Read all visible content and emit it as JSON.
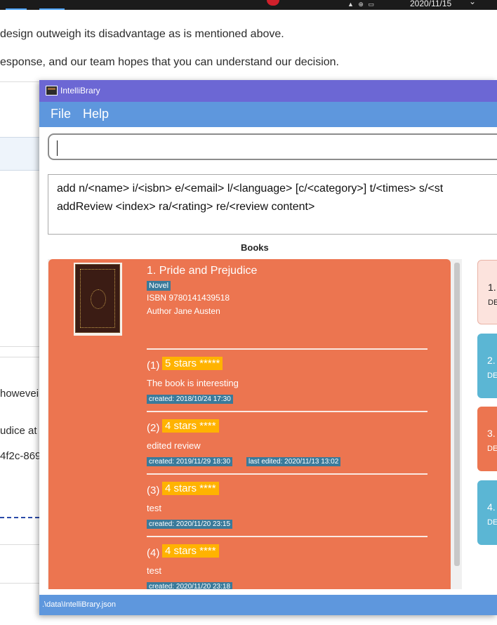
{
  "taskbar": {
    "date": "2020/11/15",
    "chevron": "⌄",
    "tray": "▲  ⊕  ▭"
  },
  "background": {
    "line1": "design outweigh its disadvantage as is mentioned above.",
    "line2": "esponse, and our team hopes that you can understand our decision.",
    "frag_however": "howevei",
    "frag_udice": "udice at",
    "frag_hash": "4f2c-869"
  },
  "window": {
    "title": "IntelliBrary",
    "menu": {
      "file": "File",
      "help": "Help"
    },
    "command": {
      "value": "",
      "placeholder": ""
    },
    "result": {
      "line1": "add n/<name> i/<isbn> e/<email> l/<language> [c/<category>] t/<times> s/<st",
      "line2": "addReview <index> ra/<rating> re/<review content>"
    },
    "books_title": "Books",
    "book": {
      "title": "1.  Pride and Prejudice",
      "tag": "Novel",
      "isbn": "ISBN 9780141439518",
      "author": "Author Jane Austen"
    },
    "reviews": [
      {
        "index": "(1)",
        "stars": "5 stars *****",
        "rating": 5,
        "text": "The book is interesting",
        "created": "created: 2018/10/24 17:30",
        "edited": ""
      },
      {
        "index": "(2)",
        "stars": "4 stars ****",
        "rating": 4,
        "text": "edited review",
        "created": "created: 2019/11/29 18:30",
        "edited": "last edited: 2020/11/13 13:02"
      },
      {
        "index": "(3)",
        "stars": "4 stars ****",
        "rating": 4,
        "text": "test",
        "created": "created: 2020/11/20 23:15",
        "edited": ""
      },
      {
        "index": "(4)",
        "stars": "4 stars ****",
        "rating": 4,
        "text": "test",
        "created": "created: 2020/11/20 23:18",
        "edited": ""
      }
    ],
    "side_cards": [
      {
        "num": "1.",
        "sub": "DE",
        "color": "#fce3dd"
      },
      {
        "num": "2.",
        "sub": "DE",
        "color": "#5bb6d4"
      },
      {
        "num": "3.",
        "sub": "DE",
        "color": "#ec7550"
      },
      {
        "num": "4.",
        "sub": "DE",
        "color": "#5bb6d4"
      }
    ],
    "status": ".\\data\\IntelliBrary.json"
  },
  "colors": {
    "title_bar": "#6c67d4",
    "menu_bar": "#5e97dd",
    "book_card": "#ec7550",
    "star_badge": "#ffb300",
    "tag": "#3a7a9a"
  }
}
